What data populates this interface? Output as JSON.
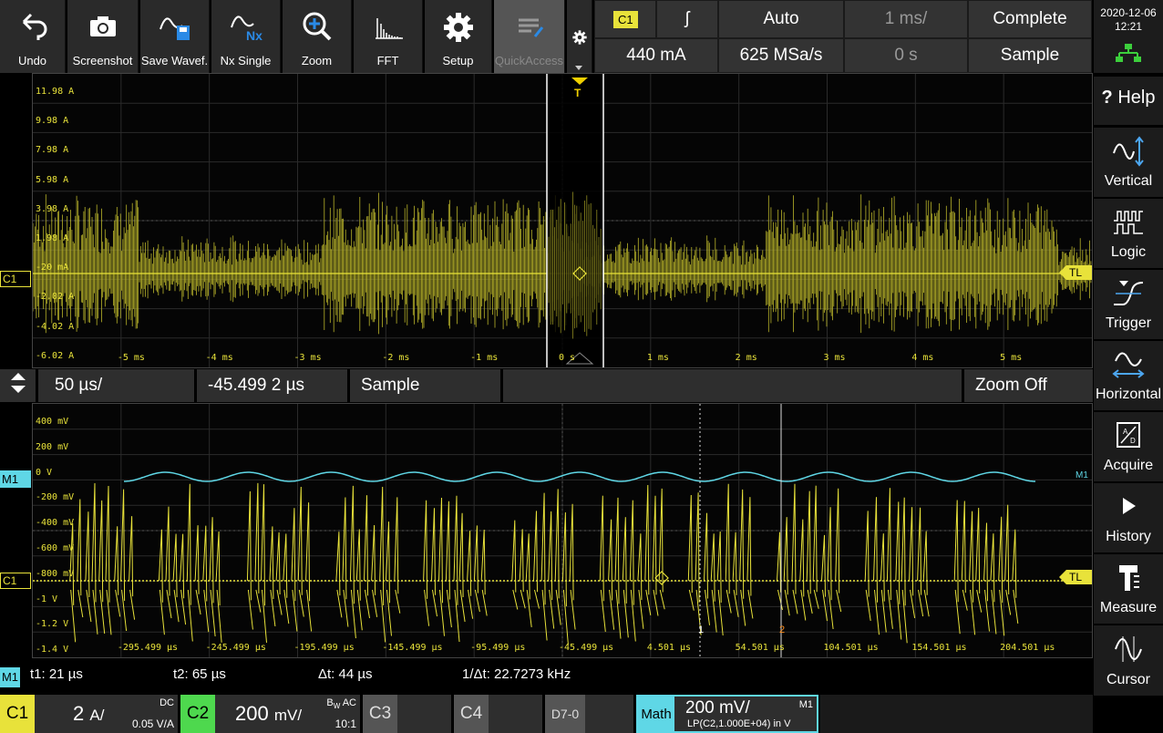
{
  "toolbar": {
    "items": [
      {
        "label": "Undo",
        "icon": "undo-icon"
      },
      {
        "label": "Screenshot",
        "icon": "camera-icon"
      },
      {
        "label": "Save Wavef.",
        "icon": "save-waveform-icon"
      },
      {
        "label": "Nx Single",
        "icon": "nx-single-icon"
      },
      {
        "label": "Zoom",
        "icon": "zoom-icon"
      },
      {
        "label": "FFT",
        "icon": "fft-icon"
      },
      {
        "label": "Setup",
        "icon": "setup-gear-icon"
      },
      {
        "label": "QuickAccess",
        "icon": "quickaccess-icon"
      }
    ]
  },
  "trigger": {
    "source": "C1",
    "edge": "ʃ",
    "mode": "Auto",
    "timebase": "1 ms/",
    "acq_status": "Complete",
    "level": "440 mA",
    "sample_rate": "625 MSa/s",
    "position": "0 s",
    "acq_mode": "Sample"
  },
  "datetime": {
    "date": "2020-12-06",
    "time": "12:21"
  },
  "side": {
    "help": "Help",
    "items": [
      {
        "label": "Vertical",
        "icon": "vertical-icon"
      },
      {
        "label": "Logic",
        "icon": "logic-icon"
      },
      {
        "label": "Trigger",
        "icon": "trigger-icon"
      },
      {
        "label": "Horizontal",
        "icon": "horizontal-icon"
      },
      {
        "label": "Acquire",
        "icon": "acquire-icon"
      },
      {
        "label": "History",
        "icon": "history-play-icon"
      },
      {
        "label": "Measure",
        "icon": "measure-icon"
      },
      {
        "label": "Cursor",
        "icon": "cursor-icon"
      }
    ]
  },
  "main": {
    "channel_tag": "C1",
    "trigger_marker": "T",
    "level_tag": "TL",
    "y_labels": [
      "11.98 A",
      "9.98 A",
      "7.98 A",
      "5.98 A",
      "3.98 A",
      "1.98 A",
      "-20 mA",
      "-2.02 A",
      "-4.02 A",
      "-6.02 A"
    ],
    "x_labels": [
      "-5 ms",
      "-4 ms",
      "-3 ms",
      "-2 ms",
      "-1 ms",
      "0 s",
      "1 ms",
      "2 ms",
      "3 ms",
      "4 ms",
      "5 ms"
    ]
  },
  "zoom": {
    "timebase": "50 µs/",
    "position": "-45.499 2 µs",
    "mode": "Sample",
    "action": "Zoom Off"
  },
  "zoomwin": {
    "math_tag": "M1",
    "channel_tag": "C1",
    "level_tag": "TL",
    "math_label": "M1",
    "y_labels": [
      "400 mV",
      "200 mV",
      "0 V",
      "-200 mV",
      "-400 mV",
      "-600 mV",
      "-800 mV",
      "-1 V",
      "-1.2 V",
      "-1.4 V"
    ],
    "x_labels": [
      "-295.499 µs",
      "-245.499 µs",
      "-195.499 µs",
      "-145.499 µs",
      "-95.499 µs",
      "-45.499 µs",
      "4.501 µs",
      "54.501 µs",
      "104.501 µs",
      "154.501 µs",
      "204.501 µs"
    ],
    "cursor1": "1",
    "cursor2": "2"
  },
  "cursor": {
    "tag": "M1",
    "t1": "t1: 21 µs",
    "t2": "t2: 65 µs",
    "dt": "Δt: 44 µs",
    "inv_dt": "1/Δt: 22.7273 kHz"
  },
  "channels": {
    "c1": {
      "tag": "C1",
      "scale": "2",
      "unit": "A/",
      "coupling": "DC",
      "probe": "0.05 V/A"
    },
    "c2": {
      "tag": "C2",
      "scale": "200",
      "unit": "mV/",
      "bw": "B",
      "bw_sub": "W",
      "coupling": "AC",
      "ratio": "10:1"
    },
    "c3": {
      "tag": "C3"
    },
    "c4": {
      "tag": "C4"
    },
    "digital": {
      "tag": "D7-0"
    },
    "math": {
      "tag": "Math",
      "scale": "200 mV/",
      "id": "M1",
      "expr": "LP(C2,1.000E+04) in V"
    }
  },
  "colors": {
    "ch1": "#e8e23a",
    "math": "#5fd7e6",
    "ch2": "#4ed84e",
    "bg": "#000000"
  }
}
